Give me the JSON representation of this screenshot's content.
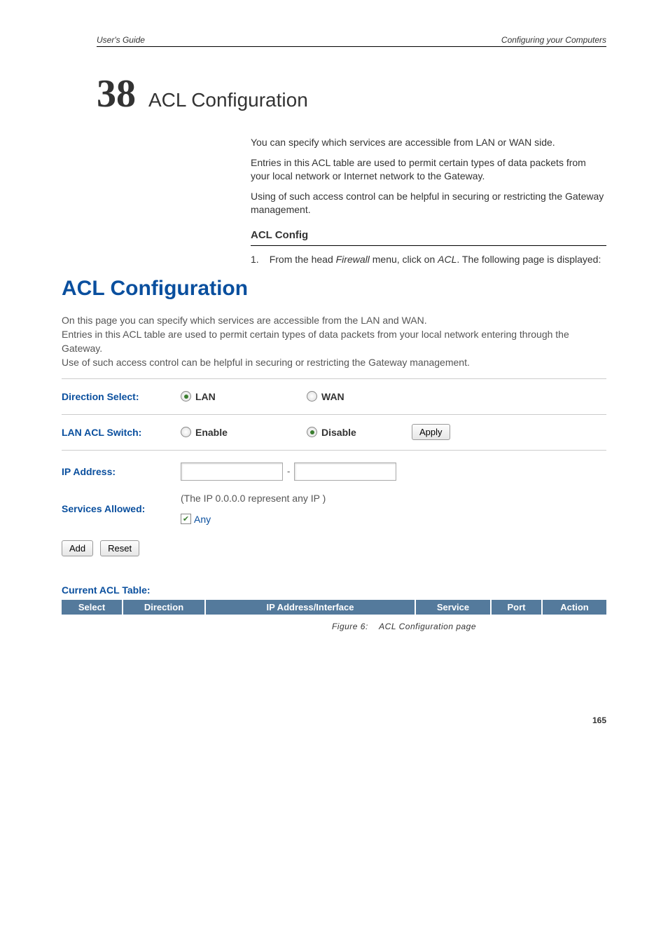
{
  "header": {
    "left": "User's Guide",
    "right": "Configuring your Computers"
  },
  "chapter": {
    "num": "38",
    "title": "ACL Configuration"
  },
  "intro": {
    "p1": "You can specify which services are accessible from LAN or WAN side.",
    "p2": "Entries in this ACL table are used to permit certain types of data packets from your local network or Internet network to the Gateway.",
    "p3": "Using of such access control can be helpful in securing or restricting the Gateway management."
  },
  "section": {
    "heading": "ACL Config"
  },
  "step": {
    "num": "1.",
    "text_prefix": "From the head ",
    "firewall": "Firewall",
    "mid": " menu, click on ",
    "acl": "ACL",
    "suffix": ". The following page is displayed:"
  },
  "acl_page": {
    "title": "ACL Configuration",
    "intro_l1": "On this page you can specify which services are accessible from the LAN and WAN.",
    "intro_l2": "Entries in this ACL table are used to permit certain types of data packets from your local network entering through the Gateway.",
    "intro_l3": "Use of such access control can be helpful in securing or restricting the Gateway management."
  },
  "form": {
    "direction_label": "Direction Select:",
    "lan": "LAN",
    "wan": "WAN",
    "switch_label": "LAN ACL Switch:",
    "enable": "Enable",
    "disable": "Disable",
    "apply": "Apply",
    "ip_label": "IP Address:",
    "ip_sep": "-",
    "ip_note": "(The IP 0.0.0.0 represent any IP )",
    "services_label": "Services Allowed:",
    "any_label": "Any",
    "add": "Add",
    "reset": "Reset"
  },
  "table": {
    "title": "Current ACL Table:",
    "cols": {
      "select": "Select",
      "direction": "Direction",
      "ip": "IP Address/Interface",
      "service": "Service",
      "port": "Port",
      "action": "Action"
    }
  },
  "figure": {
    "label": "Figure 6:",
    "caption": "ACL  Configuration  page"
  },
  "page_num": "165"
}
